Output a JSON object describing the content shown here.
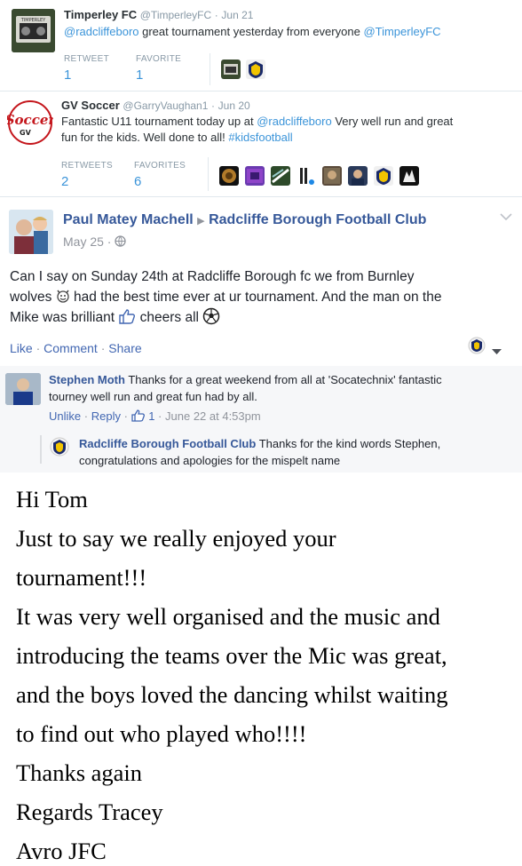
{
  "tweet1": {
    "name": "Timperley FC",
    "handle": "@TimperleyFC",
    "sep": "·",
    "date": "Jun 21",
    "mention": "@radcliffeboro",
    "text": "great tournament yesterday from everyone",
    "mention2": "@TimperleyFC",
    "stats": [
      {
        "label": "RETWEET",
        "value": "1"
      },
      {
        "label": "FAVORITE",
        "value": "1"
      }
    ],
    "avatar_logo_text": "TIMPERLEY"
  },
  "tweet2": {
    "name": "GV Soccer",
    "handle": "@GarryVaughan1",
    "sep": "·",
    "date": "Jun 20",
    "text_a": "Fantastic U11 tournament today up at",
    "mention": "@radcliffeboro",
    "text_b": "Very well run and great",
    "text_c": "fun for the kids. Well done to all!",
    "hashtag": "#kidsfootball",
    "stats": [
      {
        "label": "RETWEETS",
        "value": "2"
      },
      {
        "label": "FAVORITES",
        "value": "6"
      }
    ],
    "avatar_logo_text": "Soccer",
    "avatar_logo_sub": "GV"
  },
  "facebook": {
    "author": "Paul Matey Machell",
    "arrow": "▶",
    "page": "Radcliffe Borough Football Club",
    "date": "May 25 ·",
    "body": [
      "Can I say on Sunday 24th at Radcliffe Borough fc we from Burnley",
      "wolves",
      "had the best time ever at ur tournament. And the man on the",
      "Mike was brilliant",
      "cheers all"
    ],
    "actions": {
      "like": "Like",
      "comment": "Comment",
      "share": "Share",
      "dot": "·"
    },
    "comment1": {
      "name": "Stephen Moth",
      "text_a": "Thanks for a great weekend from all at 'Socatechnix' fantastic",
      "text_b": "tourney well run and great fun had by all.",
      "unlike": "Unlike",
      "reply": "Reply",
      "likes": "1",
      "date": "June 22 at 4:53pm"
    },
    "reply1": {
      "name": "Radcliffe Borough Football Club",
      "text_a": "Thanks for the kind words Stephen,",
      "text_b": "congratulations and apologies for the mispelt name"
    }
  },
  "letter": [
    "Hi Tom",
    "Just to say we really enjoyed your",
    "tournament!!!",
    "It was very well organised and the music and",
    "introducing the teams over the Mic was great,",
    "and the boys loved the dancing whilst waiting",
    "to find out who played who!!!!",
    "Thanks again",
    "Regards Tracey",
    "Avro JFC"
  ],
  "colors": {
    "twitter_link": "#3b94d9",
    "fb_blue": "#365899",
    "fb_action": "#4267b2"
  }
}
